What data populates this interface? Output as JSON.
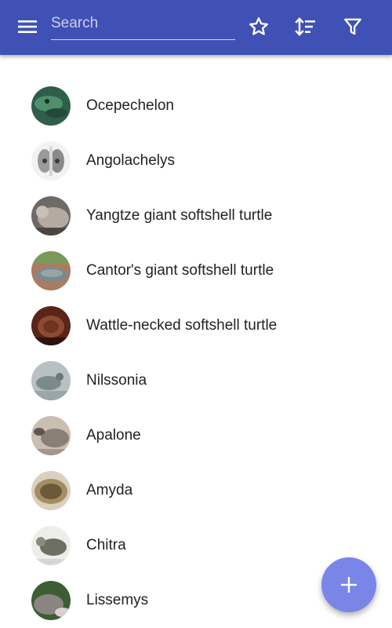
{
  "appbar": {
    "menu_icon": "menu-icon",
    "search_placeholder": "Search",
    "search_value": "",
    "actions": [
      "star-icon",
      "sort-icon",
      "filter-icon"
    ],
    "background": "#3f51b5"
  },
  "list": {
    "items": [
      {
        "label": "Ocepechelon",
        "thumb": [
          "#2f5e4a",
          "#4f8f6e"
        ]
      },
      {
        "label": "Angolachelys",
        "thumb": [
          "#f2f2f2",
          "#8a8a8a"
        ]
      },
      {
        "label": "Yangtze giant softshell turtle",
        "thumb": [
          "#6e6a66",
          "#b4aaa2"
        ]
      },
      {
        "label": "Cantor's giant softshell turtle",
        "thumb": [
          "#a97c62",
          "#7a8a8e"
        ]
      },
      {
        "label": "Wattle-necked softshell turtle",
        "thumb": [
          "#5a2418",
          "#8d4a33"
        ]
      },
      {
        "label": "Nilssonia",
        "thumb": [
          "#7d8a8c",
          "#b7c0c2"
        ]
      },
      {
        "label": "Apalone",
        "thumb": [
          "#8a7f76",
          "#c9beb2"
        ]
      },
      {
        "label": "Amyda",
        "thumb": [
          "#6b5a3a",
          "#a38d63"
        ]
      },
      {
        "label": "Chitra",
        "thumb": [
          "#d8d6d2",
          "#6d6e64"
        ]
      },
      {
        "label": "Lissemys",
        "thumb": [
          "#3d5e34",
          "#8a8580"
        ]
      }
    ]
  },
  "fab": {
    "icon": "add-icon",
    "color": "#7986e8"
  }
}
